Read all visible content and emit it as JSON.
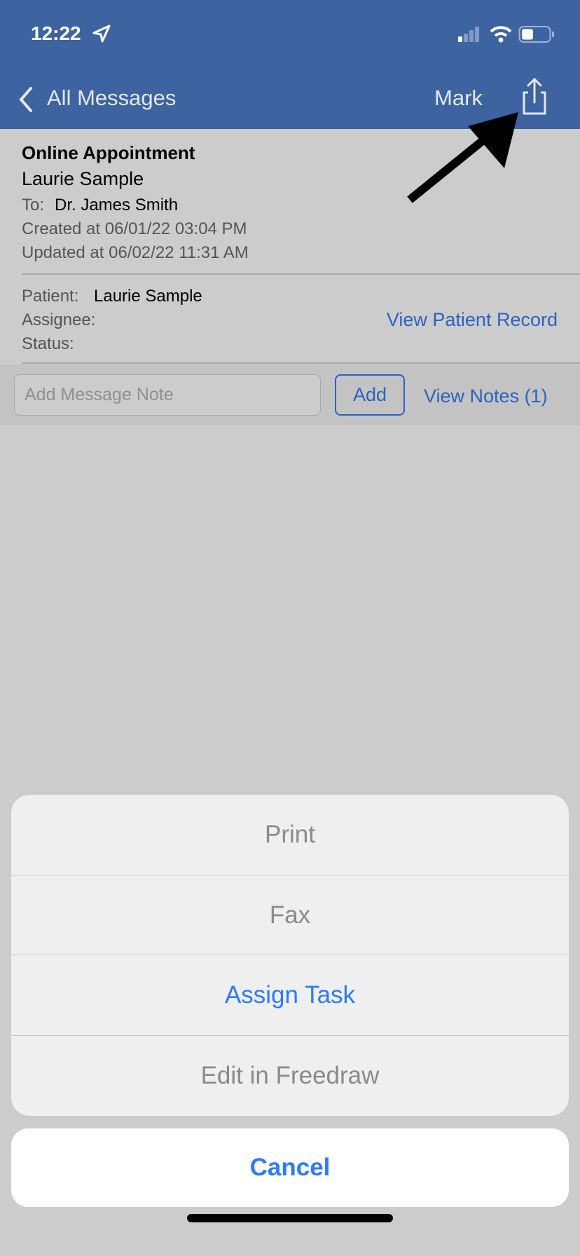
{
  "status_bar": {
    "time": "12:22"
  },
  "nav": {
    "back_label": "All Messages",
    "mark_label": "Mark",
    "share_icon": "share-icon"
  },
  "message": {
    "title": "Online Appointment",
    "sender": "Laurie Sample",
    "to_label": "To:",
    "to_value": "Dr. James Smith",
    "created": "Created at 06/01/22 03:04 PM",
    "updated": "Updated at 06/02/22 11:31 AM"
  },
  "details": {
    "patient_label": "Patient:",
    "patient_value": "Laurie Sample",
    "assignee_label": "Assignee:",
    "status_label": "Status:",
    "view_record": "View Patient Record"
  },
  "note": {
    "placeholder": "Add Message Note",
    "add_label": "Add",
    "view_notes": "View Notes (1)"
  },
  "action_sheet": {
    "items": [
      {
        "label": "Print"
      },
      {
        "label": "Fax"
      },
      {
        "label": "Assign Task"
      },
      {
        "label": "Edit in Freedraw"
      }
    ],
    "cancel": "Cancel"
  },
  "colors": {
    "nav": "#3d64a0",
    "link": "#2a63c4",
    "action": "#2f7af5"
  }
}
